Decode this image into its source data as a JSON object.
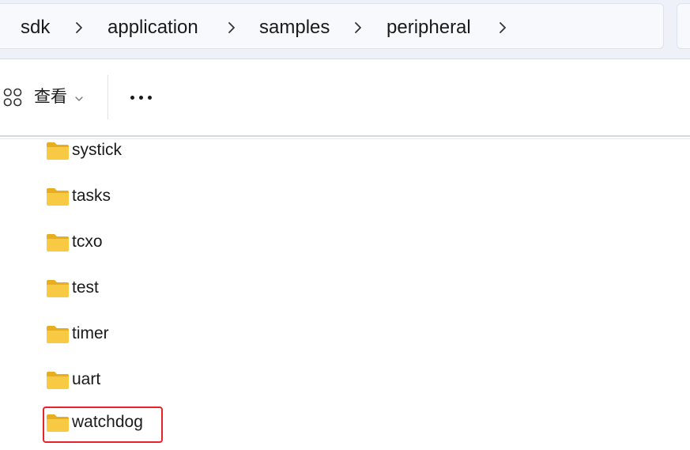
{
  "breadcrumb": {
    "items": [
      "sdk",
      "application",
      "samples",
      "peripheral"
    ]
  },
  "command_bar": {
    "view_label": "查看",
    "view_icon": "grid-view-icon",
    "more_icon": "more-ellipsis-icon"
  },
  "files": {
    "items": [
      {
        "name": "systick",
        "type": "folder"
      },
      {
        "name": "tasks",
        "type": "folder"
      },
      {
        "name": "tcxo",
        "type": "folder"
      },
      {
        "name": "test",
        "type": "folder"
      },
      {
        "name": "timer",
        "type": "folder"
      },
      {
        "name": "uart",
        "type": "folder"
      },
      {
        "name": "watchdog",
        "type": "folder",
        "highlighted": true
      }
    ]
  },
  "colors": {
    "folder_body": "#f8c942",
    "folder_tab": "#e9ad20",
    "highlight_border": "#e8242a",
    "address_bg": "#eef2f8"
  }
}
